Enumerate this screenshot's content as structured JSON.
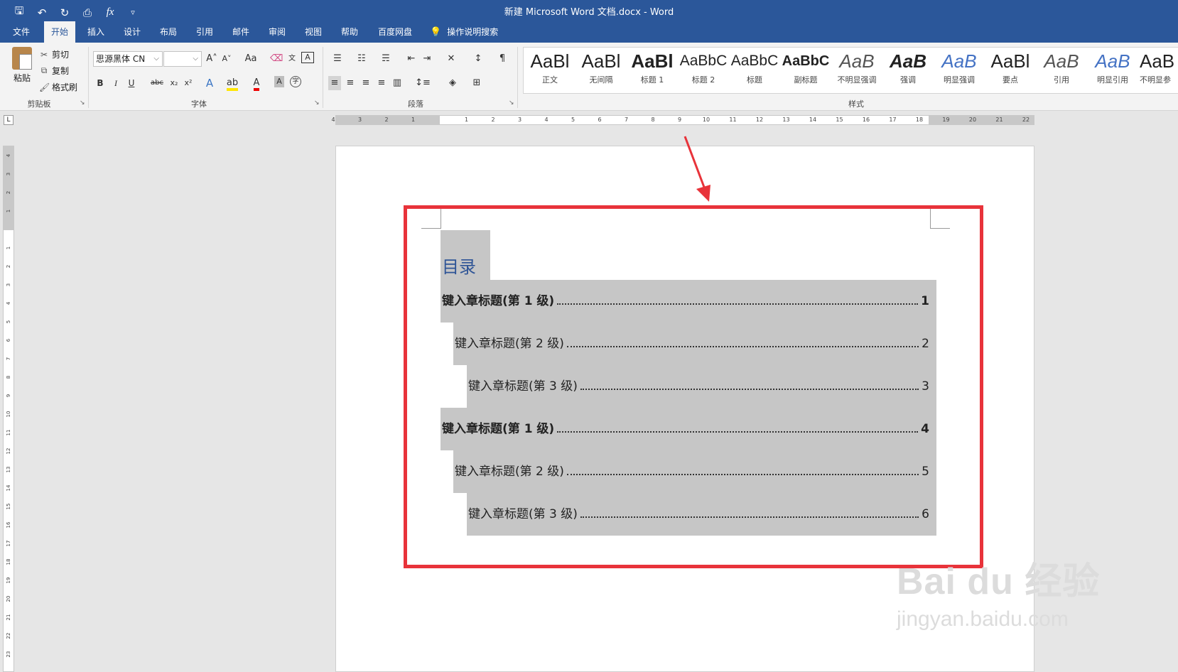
{
  "titlebar": {
    "title": "新建 Microsoft Word 文档.docx  -  Word",
    "qat_icons": [
      "save-icon",
      "undo-icon",
      "redo-icon",
      "print-preview-icon",
      "formula-icon",
      "customize-qat-icon"
    ],
    "qat_glyphs": [
      "🖫",
      "↶",
      "↻",
      "⎙",
      "fx",
      "▿"
    ]
  },
  "tabs": {
    "file": "文件",
    "home": "开始",
    "insert": "插入",
    "design": "设计",
    "layout": "布局",
    "references": "引用",
    "mailings": "邮件",
    "review": "审阅",
    "view": "视图",
    "help": "帮助",
    "baidu": "百度网盘",
    "tell_me": "操作说明搜索"
  },
  "clipboard": {
    "paste": "粘贴",
    "cut": "剪切",
    "copy": "复制",
    "format_painter": "格式刷",
    "label": "剪贴板"
  },
  "font": {
    "name": "思源黑体 CN",
    "size": "",
    "label": "字体",
    "grow": "A˄",
    "shrink": "A˅",
    "case": "Aa",
    "bold": "B",
    "italic": "I",
    "underline": "U",
    "strike": "abc",
    "subscript": "x₂",
    "superscript": "x²"
  },
  "paragraph": {
    "label": "段落"
  },
  "styles": {
    "label": "样式",
    "items": [
      {
        "preview": "AaBl",
        "name": "正文"
      },
      {
        "preview": "AaBl",
        "name": "无间隔"
      },
      {
        "preview": "AaBl",
        "name": "标题 1"
      },
      {
        "preview": "AaBbC",
        "name": "标题 2"
      },
      {
        "preview": "AaBbC",
        "name": "标题"
      },
      {
        "preview": "AaBbC",
        "name": "副标题"
      },
      {
        "preview": "AaB",
        "name": "不明显强调"
      },
      {
        "preview": "AaB",
        "name": "强调"
      },
      {
        "preview": "AaB",
        "name": "明显强调"
      },
      {
        "preview": "AaBl",
        "name": "要点"
      },
      {
        "preview": "AaB",
        "name": "引用"
      },
      {
        "preview": "AaB",
        "name": "明显引用"
      },
      {
        "preview": "AaB",
        "name": "不明显参"
      }
    ]
  },
  "ruler": {
    "h_labels": [
      "4",
      "3",
      "2",
      "1",
      "1",
      "2",
      "3",
      "4",
      "5",
      "6",
      "7",
      "8",
      "9",
      "10",
      "11",
      "12",
      "13",
      "14",
      "15",
      "16",
      "17",
      "18",
      "19",
      "20",
      "21",
      "22"
    ],
    "v_labels": [
      "4",
      "3",
      "2",
      "1",
      "1",
      "2",
      "3",
      "4",
      "5",
      "6",
      "7",
      "8",
      "9",
      "10",
      "11",
      "12",
      "13",
      "14",
      "15",
      "16",
      "17",
      "18",
      "19",
      "20",
      "21",
      "22",
      "23"
    ]
  },
  "document": {
    "toc_title": "目录",
    "entries": [
      {
        "text": "键入章标题(第 1 级)",
        "page": "1",
        "level": 1
      },
      {
        "text": "键入章标题(第 2 级)",
        "page": "2",
        "level": 2
      },
      {
        "text": "键入章标题(第 3 级)",
        "page": "3",
        "level": 3
      },
      {
        "text": "键入章标题(第 1 级)",
        "page": "4",
        "level": 1
      },
      {
        "text": "键入章标题(第 2 级)",
        "page": "5",
        "level": 2
      },
      {
        "text": "键入章标题(第 3 级)",
        "page": "6",
        "level": 3
      }
    ]
  },
  "annotation": {
    "highlight_color": "#e8333a"
  },
  "watermark": {
    "brand": "Bai du 经验",
    "url": "jingyan.baidu.com"
  },
  "colors": {
    "accent": "#2b579a",
    "toc_title": "#2e5496",
    "field_shading": "#c6c6c6"
  }
}
